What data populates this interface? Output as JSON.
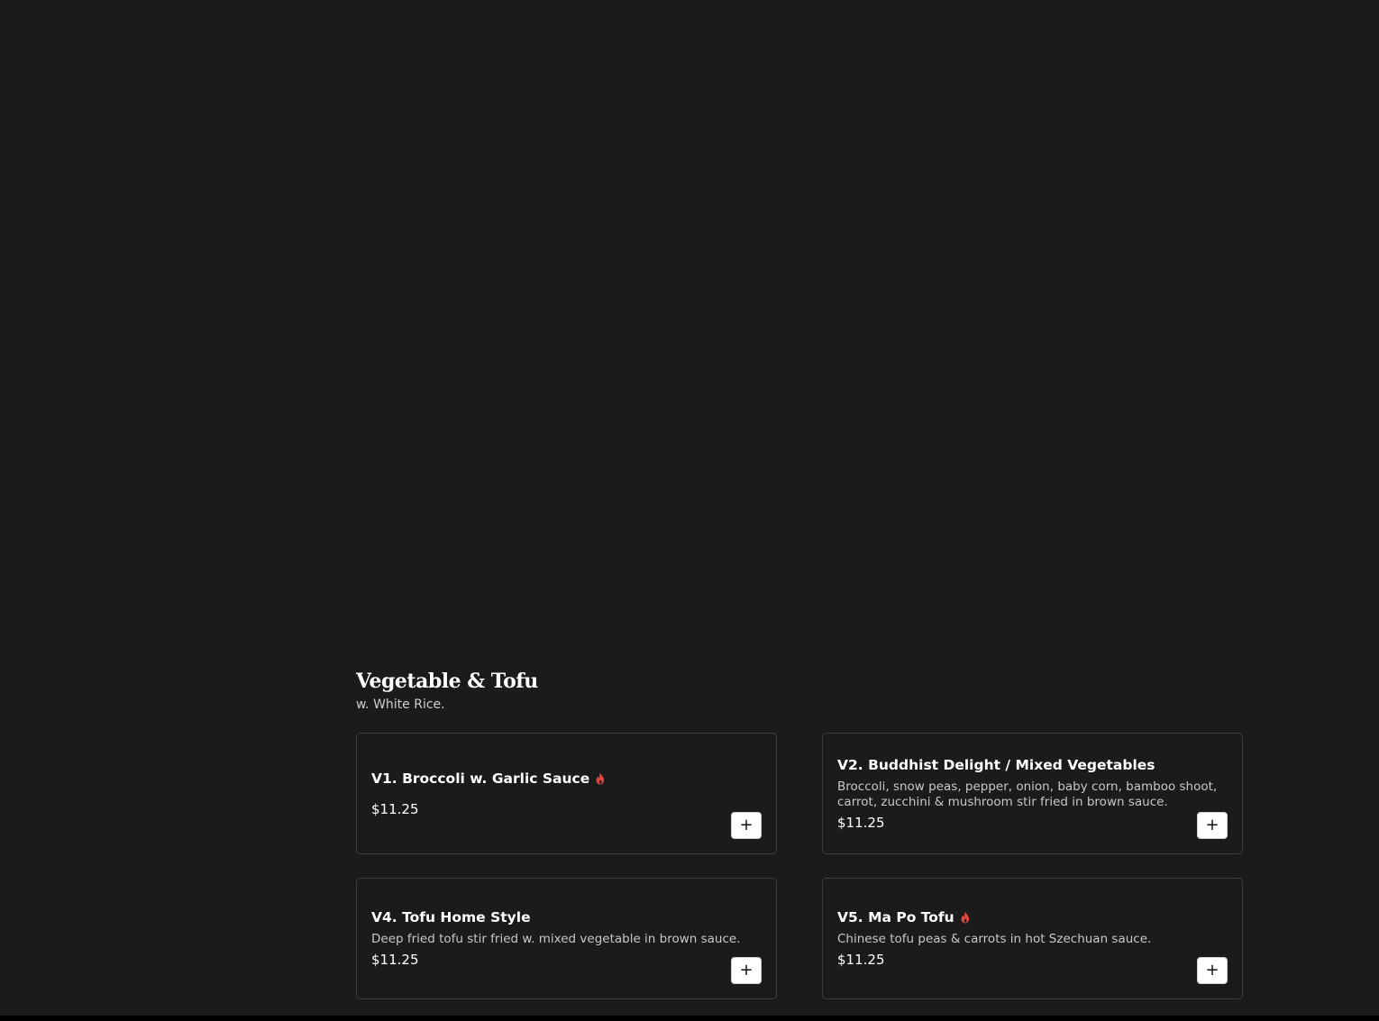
{
  "section": {
    "title": "Vegetable & Tofu",
    "subtitle": "w. White Rice."
  },
  "items": [
    {
      "name": "V1. Broccoli w. Garlic Sauce",
      "description": "",
      "price": "$11.25",
      "spicy": true,
      "add_label": "+"
    },
    {
      "name": "V2. Buddhist Delight / Mixed Vegetables",
      "description": "Broccoli, snow peas, pepper, onion, baby corn, bamboo shoot, carrot, zucchini & mushroom stir fried in brown sauce.",
      "price": "$11.25",
      "spicy": false,
      "add_label": "+"
    },
    {
      "name": "V4. Tofu Home Style",
      "description": "Deep fried tofu stir fried w. mixed vegetable in brown sauce.",
      "price": "$11.25",
      "spicy": false,
      "add_label": "+"
    },
    {
      "name": "V5. Ma Po Tofu",
      "description": "Chinese tofu peas & carrots in hot Szechuan sauce.",
      "price": "$11.25",
      "spicy": true,
      "add_label": "+"
    }
  ],
  "colors": {
    "background": "#1b1b1b",
    "spicy_icon": "#e0483e",
    "card_border": "#3d3d3d"
  },
  "icons": {
    "spicy": "flame-icon",
    "add": "plus-icon"
  }
}
